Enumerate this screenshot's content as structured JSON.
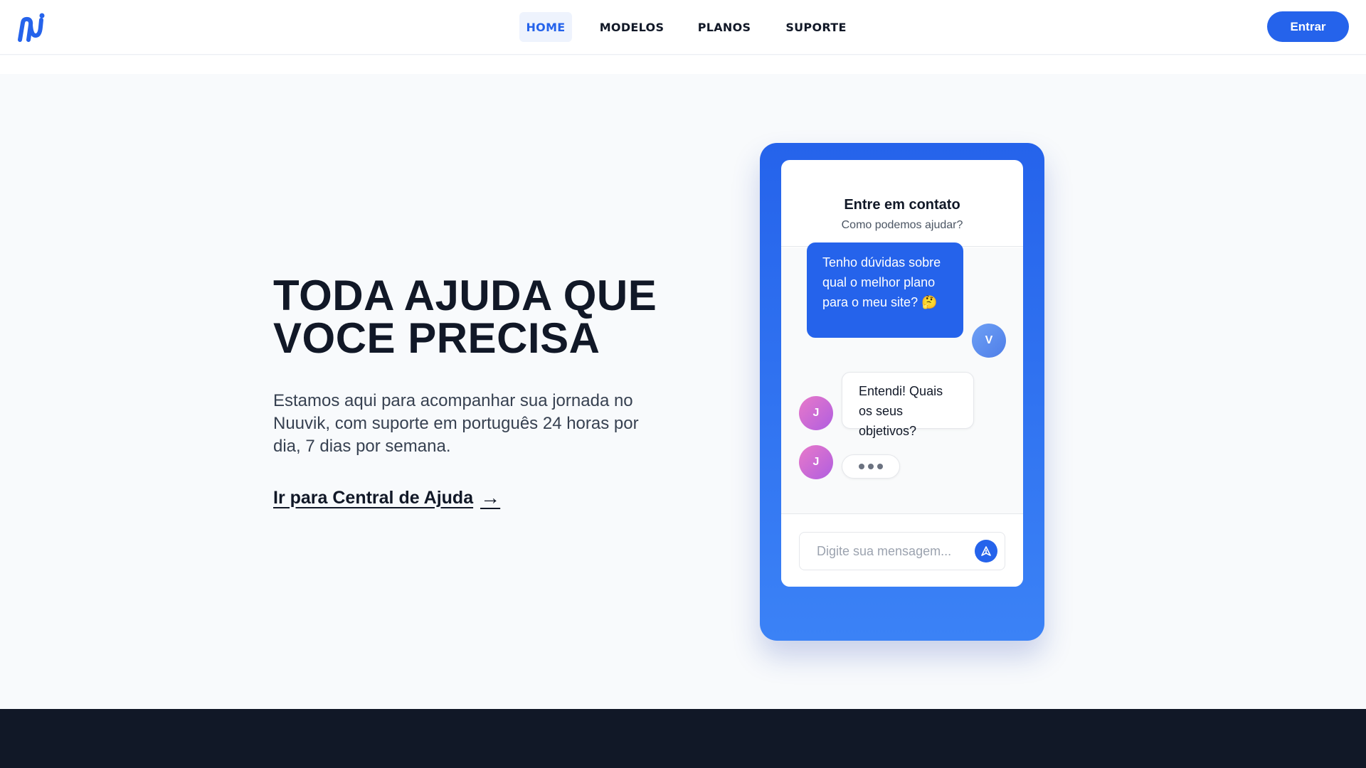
{
  "brand": {
    "logo_icon": "nuuvik-logo-icon",
    "accent_color": "#2563eb"
  },
  "nav": {
    "items": [
      {
        "label": "HOME",
        "active": true
      },
      {
        "label": "MODELOS",
        "active": false
      },
      {
        "label": "PLANOS",
        "active": false
      },
      {
        "label": "SUPORTE",
        "active": false
      }
    ],
    "login_label": "Entrar"
  },
  "hero": {
    "title_line1": "TODA AJUDA QUE",
    "title_line2": "VOCE PRECISA",
    "description": "Estamos aqui para acompanhar sua jornada no Nuuvik, com suporte em português 24 horas por dia, 7 dias por semana.",
    "link_label": "Ir para Central de Ajuda",
    "link_arrow": "→"
  },
  "chat": {
    "title": "Entre em contato",
    "subtitle": "Como podemos ajudar?",
    "user_message": "Tenho dúvidas sobre qual o melhor plano para o meu site? 🤔",
    "user_avatar": "V",
    "agent_message": "Entendi! Quais os seus objetivos?",
    "agent_avatar": "J",
    "input_placeholder": "Digite sua mensagem...",
    "send_icon": "send-icon"
  }
}
